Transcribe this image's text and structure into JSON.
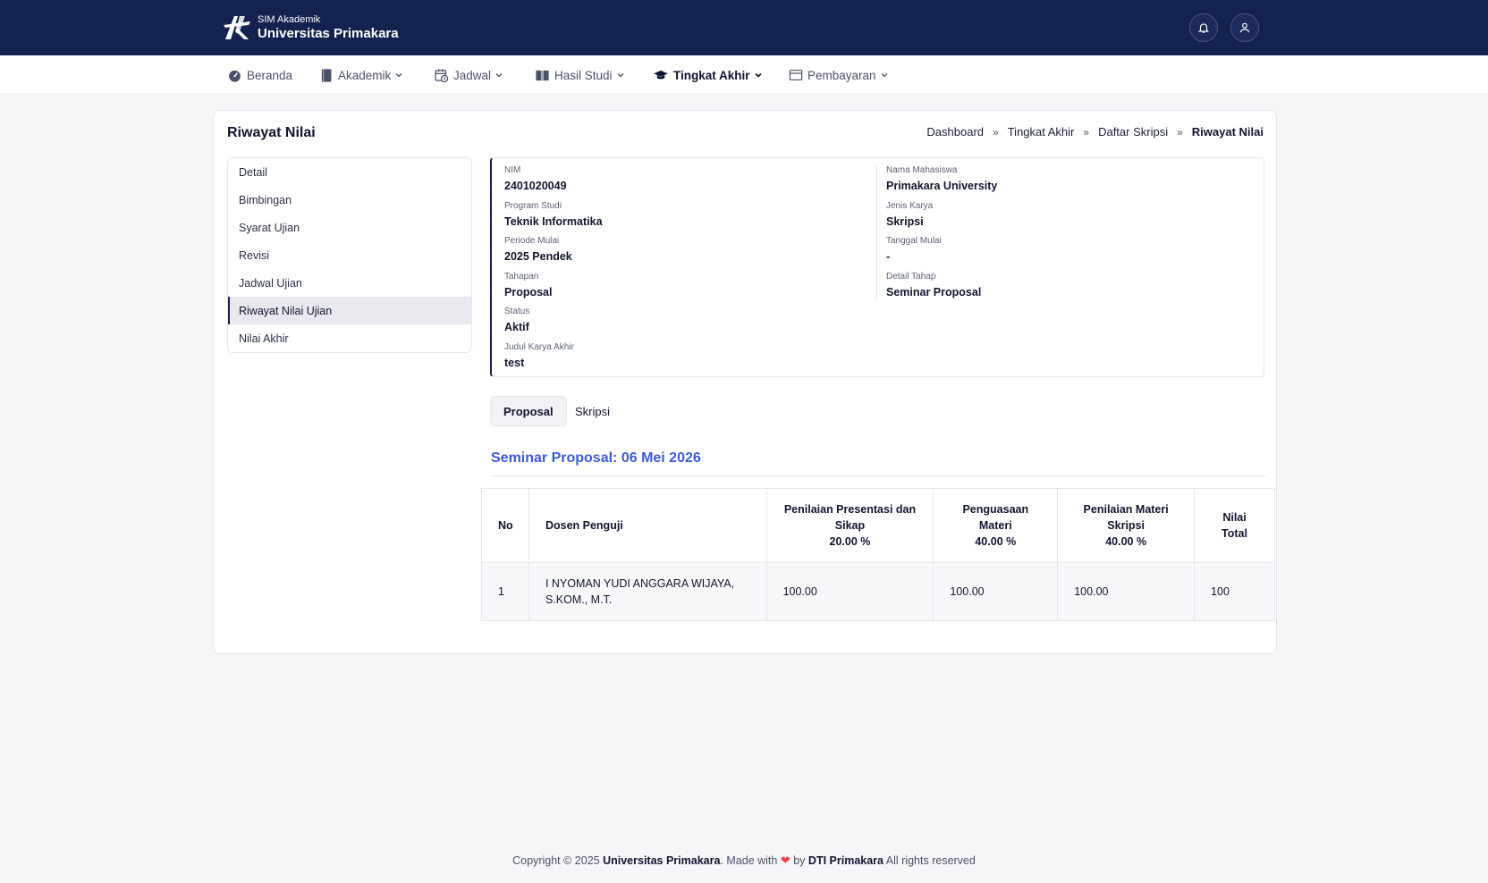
{
  "header": {
    "app_subtitle": "SIM Akademik",
    "app_title": "Universitas Primakara"
  },
  "nav": {
    "items": [
      {
        "label": "Beranda",
        "icon": "dashboard-icon",
        "active": false
      },
      {
        "label": "Akademik",
        "icon": "book-icon",
        "active": false
      },
      {
        "label": "Jadwal",
        "icon": "calendar-clock-icon",
        "active": false
      },
      {
        "label": "Hasil Studi",
        "icon": "open-book-icon",
        "active": false
      },
      {
        "label": "Tingkat Akhir",
        "icon": "graduation-cap-icon",
        "active": true
      },
      {
        "label": "Pembayaran",
        "icon": "payment-window-icon",
        "active": false
      }
    ]
  },
  "page": {
    "title": "Riwayat Nilai",
    "breadcrumb": [
      "Dashboard",
      "Tingkat Akhir",
      "Daftar Skripsi",
      "Riwayat Nilai"
    ],
    "breadcrumb_separator": "»"
  },
  "sidemenu": {
    "items": [
      {
        "label": "Detail"
      },
      {
        "label": "Bimbingan"
      },
      {
        "label": "Syarat Ujian"
      },
      {
        "label": "Revisi"
      },
      {
        "label": "Jadwal Ujian"
      },
      {
        "label": "Riwayat Nilai Ujian",
        "active": true
      },
      {
        "label": "Nilai Akhir"
      }
    ]
  },
  "info": {
    "left": [
      {
        "label": "NIM",
        "value": "2401020049"
      },
      {
        "label": "Program Studi",
        "value": "Teknik Informatika"
      },
      {
        "label": "Periode Mulai",
        "value": "2025 Pendek"
      },
      {
        "label": "Tahapan",
        "value": "Proposal"
      },
      {
        "label": "Status",
        "value": "Aktif"
      },
      {
        "label": "Judul Karya Akhir",
        "value": "test"
      }
    ],
    "right": [
      {
        "label": "Nama Mahasiswa",
        "value": "Primakara University"
      },
      {
        "label": "Jenis Karya",
        "value": "Skripsi"
      },
      {
        "label": "Tanggal Mulai",
        "value": "-"
      },
      {
        "label": "Detail Tahap",
        "value": "Seminar Proposal"
      }
    ]
  },
  "tabs": [
    {
      "label": "Proposal",
      "active": true
    },
    {
      "label": "Skripsi",
      "active": false
    }
  ],
  "section": {
    "title": "Seminar Proposal: 06 Mei 2026"
  },
  "table": {
    "headers": {
      "no": "No",
      "dosen": "Dosen Penguji",
      "presentasi_line1": "Penilaian Presentasi dan",
      "presentasi_line2": "Sikap",
      "presentasi_weight": "20.00 %",
      "penguasaan_line1": "Penguasaan",
      "penguasaan_line2": "Materi",
      "penguasaan_weight": "40.00 %",
      "materi_line1": "Penilaian Materi",
      "materi_line2": "Skripsi",
      "materi_weight": "40.00 %",
      "total_line1": "Nilai",
      "total_line2": "Total"
    },
    "rows": [
      {
        "no": "1",
        "dosen_line1": "I NYOMAN YUDI ANGGARA WIJAYA,",
        "dosen_line2": "S.KOM., M.T.",
        "presentasi": "100.00",
        "penguasaan": "100.00",
        "materi": "100.00",
        "total": "100"
      }
    ]
  },
  "footer": {
    "prefix": "Copyright © 2025",
    "org": "Universitas Primakara",
    "made_with": ". Made with",
    "heart": "❤",
    "by": "by",
    "team": "DTI Primakara",
    "suffix": "All rights reserved"
  },
  "colors": {
    "header_bg": "#142250",
    "accent_title": "#3b5bdb",
    "heart": "#e5484d"
  }
}
